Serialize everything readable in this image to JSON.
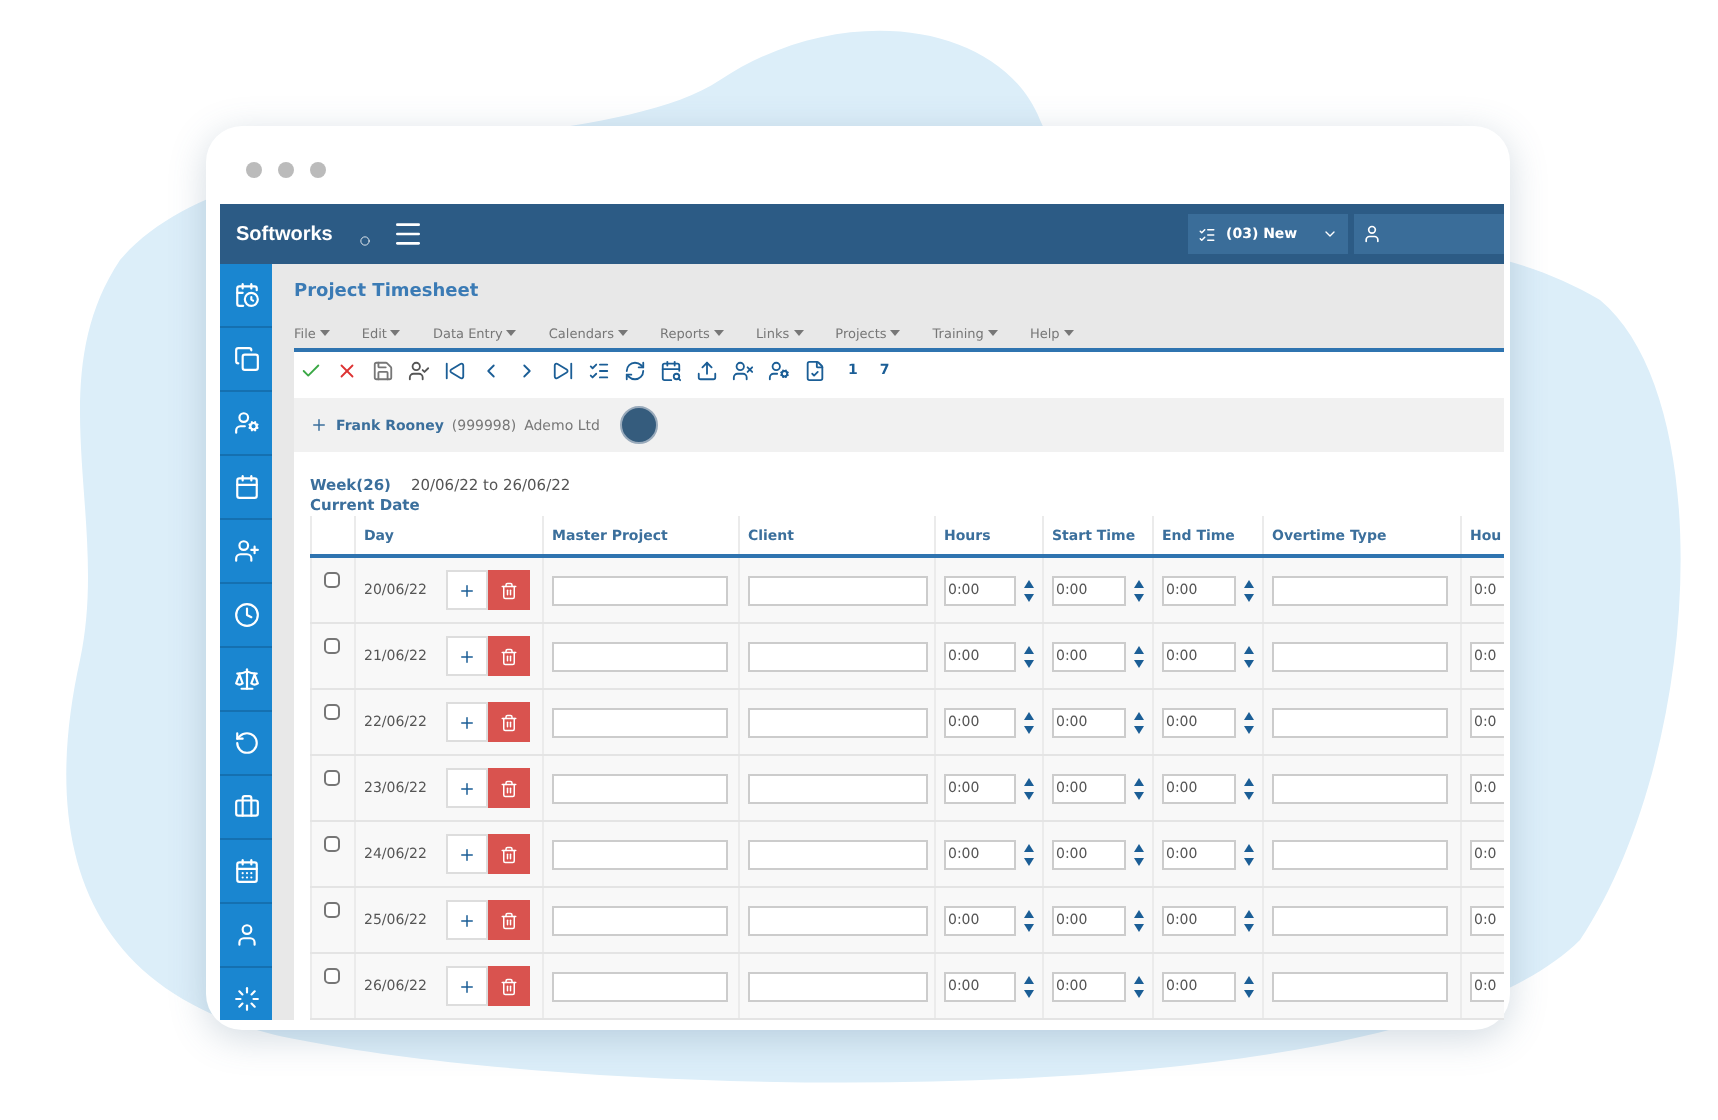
{
  "topbar": {
    "logo": "Softworks",
    "dropdown": "(03) New"
  },
  "title": "Project Timesheet",
  "menu": [
    "File",
    "Edit",
    "Data Entry",
    "Calendars",
    "Reports",
    "Links",
    "Projects",
    "Training",
    "Help"
  ],
  "toolbar": {
    "counters": [
      "1",
      "7"
    ]
  },
  "employee": {
    "name": "Frank Rooney",
    "code": "(999998)",
    "company": "Ademo Ltd"
  },
  "week": {
    "label": "Week(26)",
    "range": "20/06/22 to 26/06/22",
    "current": "Current Date"
  },
  "table": {
    "columns": [
      "Day",
      "Master Project",
      "Client",
      "Hours",
      "Start Time",
      "End Time",
      "Overtime Type",
      "Hou"
    ],
    "rows": [
      {
        "day": "20/06/22",
        "checked": false,
        "hours": "0:00",
        "start": "0:00",
        "end": "0:00",
        "extra": "0:0"
      },
      {
        "day": "21/06/22",
        "checked": false,
        "hours": "0:00",
        "start": "0:00",
        "end": "0:00",
        "extra": "0:0"
      },
      {
        "day": "22/06/22",
        "checked": false,
        "hours": "0:00",
        "start": "0:00",
        "end": "0:00",
        "extra": "0:0"
      },
      {
        "day": "23/06/22",
        "checked": false,
        "hours": "0:00",
        "start": "0:00",
        "end": "0:00",
        "extra": "0:0"
      },
      {
        "day": "24/06/22",
        "checked": false,
        "hours": "0:00",
        "start": "0:00",
        "end": "0:00",
        "extra": "0:0"
      },
      {
        "day": "25/06/22",
        "checked": false,
        "hours": "0:00",
        "start": "0:00",
        "end": "0:00",
        "extra": "0:0"
      },
      {
        "day": "26/06/22",
        "checked": false,
        "hours": "0:00",
        "start": "0:00",
        "end": "0:00",
        "extra": "0:0"
      }
    ]
  }
}
